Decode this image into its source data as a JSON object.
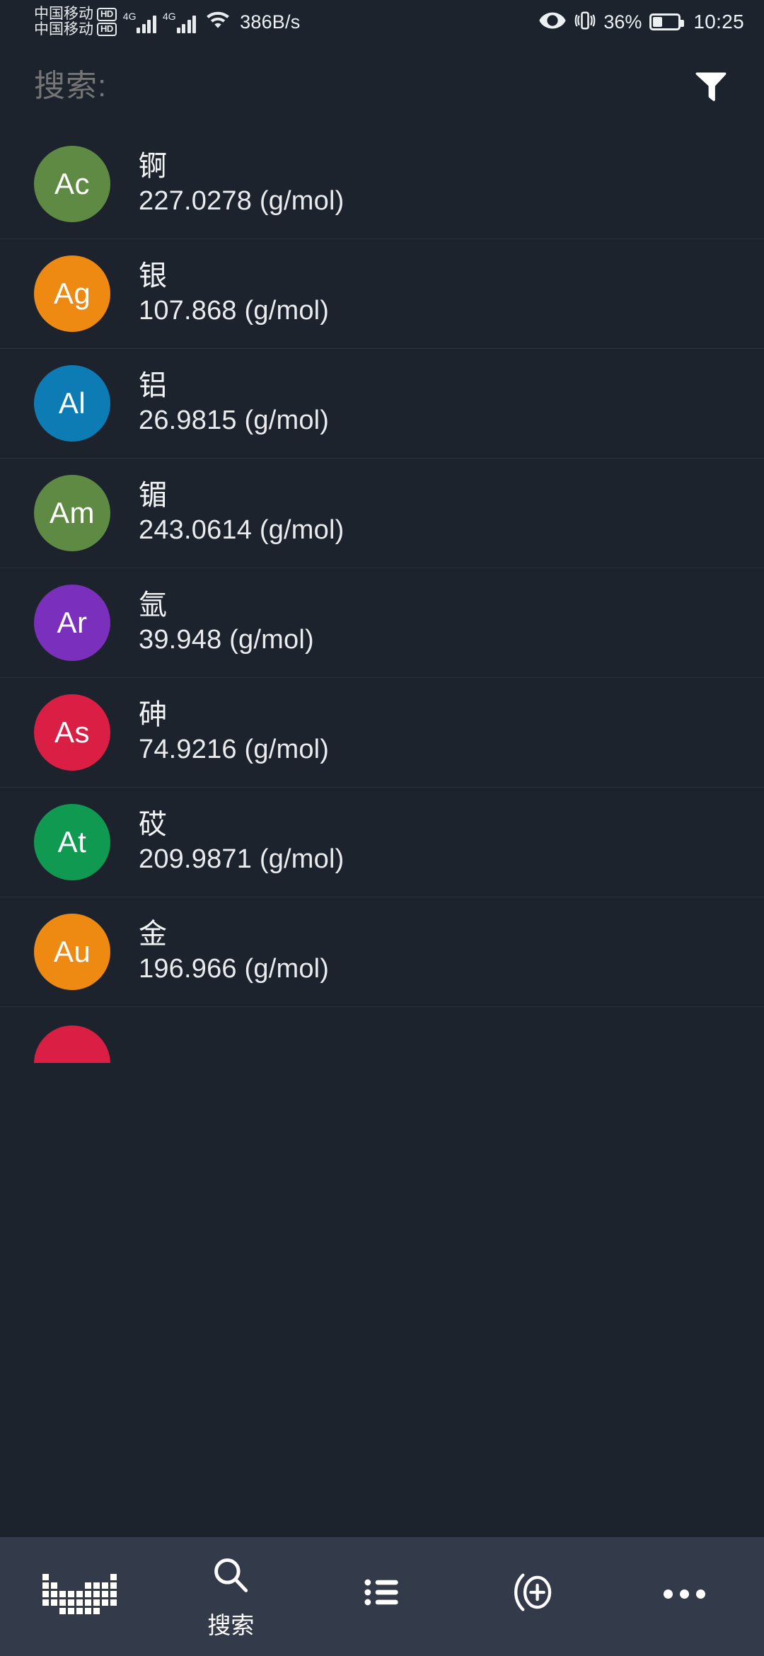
{
  "status_bar": {
    "carrier_primary": "中国移动",
    "carrier_secondary": "中国移动",
    "hd_badge": "HD",
    "network_type_sim1": "4G",
    "network_type_sim2": "4G",
    "wifi_icon": "wifi-icon",
    "network_speed": "386B/s",
    "eye_comfort_icon": "eye-icon",
    "vibrate_icon": "vibrate-icon",
    "battery_percent": "36%",
    "battery_icon": "battery-icon",
    "clock": "10:25"
  },
  "search": {
    "placeholder": "搜索:",
    "value": "",
    "filter_icon": "filter-funnel-icon"
  },
  "list": {
    "unit_suffix": "(g/mol)",
    "items": [
      {
        "symbol": "Ac",
        "name": "锕",
        "mass": "227.0278 (g/mol)",
        "color": "#5f8a43"
      },
      {
        "symbol": "Ag",
        "name": "银",
        "mass": "107.868 (g/mol)",
        "color": "#ee8a12"
      },
      {
        "symbol": "Al",
        "name": "铝",
        "mass": "26.9815 (g/mol)",
        "color": "#0d7cb5"
      },
      {
        "symbol": "Am",
        "name": "镅",
        "mass": "243.0614 (g/mol)",
        "color": "#5f8a43"
      },
      {
        "symbol": "Ar",
        "name": "氩",
        "mass": "39.948 (g/mol)",
        "color": "#7b2fbd"
      },
      {
        "symbol": "As",
        "name": "砷",
        "mass": "74.9216 (g/mol)",
        "color": "#db1e44"
      },
      {
        "symbol": "At",
        "name": "砹",
        "mass": "209.9871 (g/mol)",
        "color": "#109a51"
      },
      {
        "symbol": "Au",
        "name": "金",
        "mass": "196.966 (g/mol)",
        "color": "#ee8a12"
      },
      {
        "symbol": "",
        "name": "",
        "mass": "",
        "color": "#db1e44"
      }
    ]
  },
  "bottom_nav": {
    "items": [
      {
        "label": "",
        "icon": "periodic-table-icon",
        "active": false
      },
      {
        "label": "搜索",
        "icon": "search-icon",
        "active": true
      },
      {
        "label": "",
        "icon": "list-icon",
        "active": false
      },
      {
        "label": "",
        "icon": "add-circle-icon",
        "active": false
      },
      {
        "label": "",
        "icon": "more-icon",
        "active": false
      }
    ]
  },
  "colors": {
    "background": "#1d232c",
    "navbar_background": "#333a49",
    "divider": "#2b313b",
    "text_primary": "#f2f4f6",
    "text_placeholder": "#9aa1ab"
  }
}
